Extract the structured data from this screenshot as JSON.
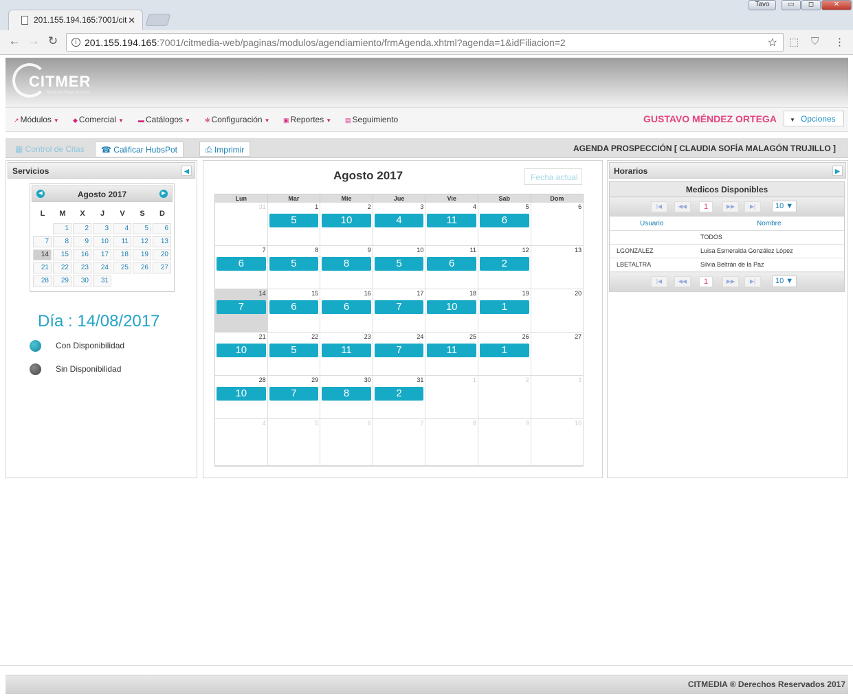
{
  "browser": {
    "tab_title": "201.155.194.165:7001/cit",
    "url_host": "201.155.194.165",
    "url_rest": ":7001/citmedia-web/paginas/modulos/agendiamiento/frmAgenda.xhtml?agenda=1&idFiliacion=2",
    "user_label": "Tavo"
  },
  "logo": {
    "text": "CITMER",
    "sub": "Medicina Reproductiva"
  },
  "menu": {
    "items": [
      "Módulos",
      "Comercial",
      "Catálogos",
      "Configuración",
      "Reportes",
      "Seguimiento"
    ],
    "user": "GUSTAVO MÉNDEZ ORTEGA",
    "options": "Opciones"
  },
  "tabs": {
    "control": "Control de Citas",
    "calificar": "Calificar HubsPot",
    "imprimir": "Imprimir",
    "agenda_title": "AGENDA PROSPECCIÓN [ CLAUDIA SOFÍA MALAGÓN TRUJILLO ]"
  },
  "servicios": {
    "title": "Servicios",
    "mini_title": "Agosto 2017",
    "day_headers": [
      "L",
      "M",
      "X",
      "J",
      "V",
      "S",
      "D"
    ],
    "weeks": [
      [
        "",
        "1",
        "2",
        "3",
        "4",
        "5",
        "6"
      ],
      [
        "7",
        "8",
        "9",
        "10",
        "11",
        "12",
        "13"
      ],
      [
        "14",
        "15",
        "16",
        "17",
        "18",
        "19",
        "20"
      ],
      [
        "21",
        "22",
        "23",
        "24",
        "25",
        "26",
        "27"
      ],
      [
        "28",
        "29",
        "30",
        "31",
        "",
        "",
        ""
      ]
    ],
    "selected_day": "14",
    "dia_label": "Día : 14/08/2017",
    "legend": [
      {
        "label": "Con Disponibilidad",
        "color": "#17879c"
      },
      {
        "label": "Sin Disponibilidad",
        "color": "#444444"
      }
    ]
  },
  "calendar": {
    "title": "Agosto 2017",
    "fecha_actual": "Fecha actual",
    "headers": [
      "Lun",
      "Mar",
      "Mie",
      "Jue",
      "Vie",
      "Sab",
      "Dom"
    ],
    "weeks": [
      [
        {
          "d": "31",
          "o": true
        },
        {
          "d": "1",
          "e": "5"
        },
        {
          "d": "2",
          "e": "10"
        },
        {
          "d": "3",
          "e": "4"
        },
        {
          "d": "4",
          "e": "11"
        },
        {
          "d": "5",
          "e": "6"
        },
        {
          "d": "6"
        }
      ],
      [
        {
          "d": "7",
          "e": "6"
        },
        {
          "d": "8",
          "e": "5"
        },
        {
          "d": "9",
          "e": "8"
        },
        {
          "d": "10",
          "e": "5"
        },
        {
          "d": "11",
          "e": "6"
        },
        {
          "d": "12",
          "e": "2"
        },
        {
          "d": "13"
        }
      ],
      [
        {
          "d": "14",
          "e": "7",
          "t": true
        },
        {
          "d": "15",
          "e": "6"
        },
        {
          "d": "16",
          "e": "6"
        },
        {
          "d": "17",
          "e": "7"
        },
        {
          "d": "18",
          "e": "10"
        },
        {
          "d": "19",
          "e": "1"
        },
        {
          "d": "20"
        }
      ],
      [
        {
          "d": "21",
          "e": "10"
        },
        {
          "d": "22",
          "e": "5"
        },
        {
          "d": "23",
          "e": "11"
        },
        {
          "d": "24",
          "e": "7"
        },
        {
          "d": "25",
          "e": "11"
        },
        {
          "d": "26",
          "e": "1"
        },
        {
          "d": "27"
        }
      ],
      [
        {
          "d": "28",
          "e": "10"
        },
        {
          "d": "29",
          "e": "7"
        },
        {
          "d": "30",
          "e": "8"
        },
        {
          "d": "31",
          "e": "2"
        },
        {
          "d": "1",
          "o": true
        },
        {
          "d": "2",
          "o": true
        },
        {
          "d": "3",
          "o": true
        }
      ],
      [
        {
          "d": "4",
          "o": true
        },
        {
          "d": "5",
          "o": true
        },
        {
          "d": "6",
          "o": true
        },
        {
          "d": "7",
          "o": true
        },
        {
          "d": "8",
          "o": true
        },
        {
          "d": "9",
          "o": true
        },
        {
          "d": "10",
          "o": true
        }
      ]
    ]
  },
  "horarios": {
    "title": "Horarios",
    "table_title": "Medicos Disponibles",
    "page": "1",
    "rows_per_page": "10 ▼",
    "col_usuario": "Usuario",
    "col_nombre": "Nombre",
    "rows": [
      {
        "usuario": "",
        "nombre": "TODOS"
      },
      {
        "usuario": "LGONZALEZ",
        "nombre": "Luisa Esmeralda González López"
      },
      {
        "usuario": "LBETALTRA",
        "nombre": "Silvia Beltrán de la Paz"
      }
    ]
  },
  "footer": {
    "text": "CITMEDIA ® Derechos Reservados 2017"
  }
}
